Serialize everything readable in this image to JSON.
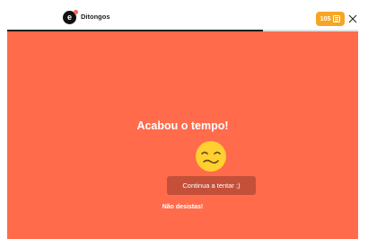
{
  "header": {
    "logo_letter": "e",
    "title": "Ditongos",
    "progress": 0.73,
    "coins": "105"
  },
  "result": {
    "title": "Acabou o tempo!",
    "emoji_icon": "smirk-face-icon",
    "retry_label": "Continua a tentar ;)",
    "encourage_text": "Não desistas!"
  },
  "colors": {
    "panel_bg": "#ff6b4b",
    "retry_button": "#c4503a",
    "coins_badge": "#f5a623",
    "progress_fill": "#1e1e1e"
  }
}
